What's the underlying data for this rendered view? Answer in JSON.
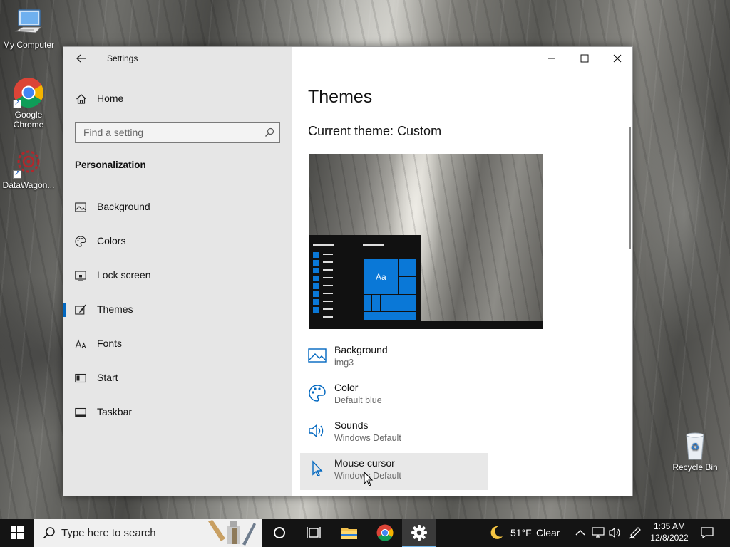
{
  "desktop": {
    "icons": [
      {
        "label": "My Computer"
      },
      {
        "label": "Google Chrome"
      },
      {
        "label": "DataWagon..."
      },
      {
        "label": "Recycle Bin"
      }
    ]
  },
  "window": {
    "title": "Settings",
    "home_label": "Home",
    "search_placeholder": "Find a setting",
    "section_heading": "Personalization",
    "nav_items": [
      {
        "label": "Background",
        "icon": "image-icon"
      },
      {
        "label": "Colors",
        "icon": "palette-icon"
      },
      {
        "label": "Lock screen",
        "icon": "lock-screen-icon"
      },
      {
        "label": "Themes",
        "icon": "themes-icon",
        "selected": true
      },
      {
        "label": "Fonts",
        "icon": "fonts-icon"
      },
      {
        "label": "Start",
        "icon": "start-icon"
      },
      {
        "label": "Taskbar",
        "icon": "taskbar-icon"
      }
    ],
    "page_title": "Themes",
    "current_theme": "Current theme: Custom",
    "preview_tile_text": "Aa",
    "theme_settings": [
      {
        "title": "Background",
        "value": "img3",
        "icon": "image-icon"
      },
      {
        "title": "Color",
        "value": "Default blue",
        "icon": "palette-icon"
      },
      {
        "title": "Sounds",
        "value": "Windows Default",
        "icon": "speaker-icon"
      },
      {
        "title": "Mouse cursor",
        "value": "Windows Default",
        "icon": "cursor-icon"
      }
    ]
  },
  "taskbar": {
    "search_placeholder": "Type here to search",
    "weather_temp": "51°F",
    "weather_text": "Clear",
    "time": "1:35 AM",
    "date": "12/8/2022"
  },
  "colors": {
    "accent": "#0067c0",
    "tile_blue": "#0a78d7",
    "taskbar_bg": "#141414"
  }
}
